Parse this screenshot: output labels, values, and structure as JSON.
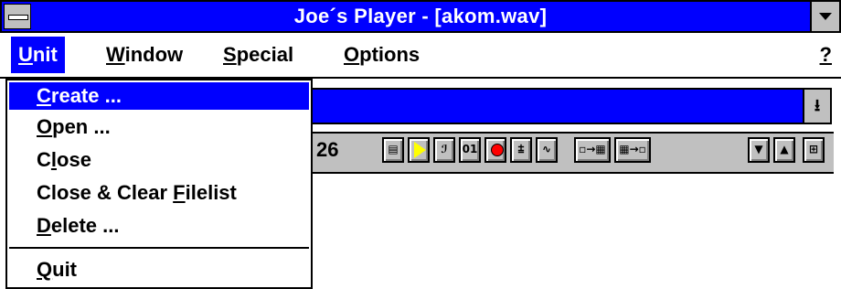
{
  "window": {
    "title": "Joe´s Player - [akom.wav]"
  },
  "menubar": {
    "items": [
      {
        "label": "Unit",
        "mnemonic": "U",
        "rest": "nit"
      },
      {
        "label": "Window",
        "mnemonic": "W",
        "rest": "indow"
      },
      {
        "label": "Special",
        "mnemonic": "S",
        "rest": "pecial"
      },
      {
        "label": "Options",
        "mnemonic": "O",
        "rest": "ptions"
      }
    ],
    "help": "?"
  },
  "unit_menu": {
    "items": [
      {
        "pre": "",
        "mn": "C",
        "post": "reate ..."
      },
      {
        "pre": "",
        "mn": "O",
        "post": "pen ..."
      },
      {
        "pre": "C",
        "mn": "l",
        "post": "ose"
      },
      {
        "pre": "Close & Clear ",
        "mn": "F",
        "post": "ilelist"
      },
      {
        "pre": "",
        "mn": "D",
        "post": "elete ..."
      },
      {
        "pre": "",
        "mn": "Q",
        "post": "uit"
      }
    ]
  },
  "player": {
    "counter": "26",
    "toolbar_icons": [
      "filelist-icon",
      "play-icon",
      "info-icon",
      "counter-01-icon",
      "record-icon",
      "level-icon",
      "waveform-icon",
      "send-to-list-icon",
      "send-from-list-icon",
      "down-arrow-icon",
      "up-arrow-icon",
      "grid-icon"
    ],
    "counter_icon_text": "01"
  }
}
